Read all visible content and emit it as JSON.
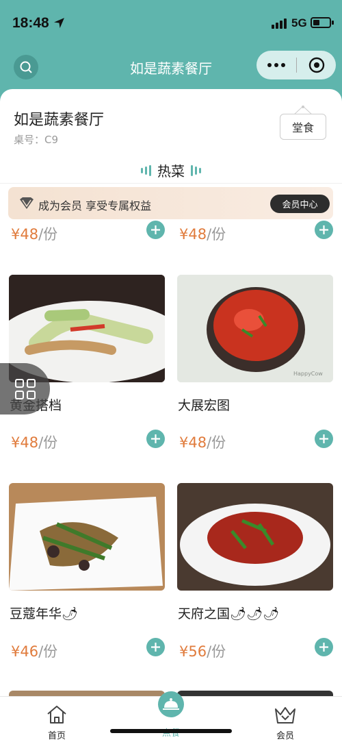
{
  "status": {
    "time": "18:48",
    "network": "5G"
  },
  "nav": {
    "title": "如是蔬素餐厅"
  },
  "restaurant": {
    "name": "如是蔬素餐厅",
    "table": "桌号：C9",
    "mode": "堂食"
  },
  "category": {
    "active": "热菜"
  },
  "member": {
    "text": "成为会员 享受专属权益",
    "button": "会员中心"
  },
  "items": [
    {
      "name": "",
      "price": "¥48",
      "unit": "/份"
    },
    {
      "name": "",
      "price": "¥48",
      "unit": "/份"
    },
    {
      "name": "黄金搭档",
      "price": "¥48",
      "unit": "/份"
    },
    {
      "name": "大展宏图",
      "price": "¥48",
      "unit": "/份"
    },
    {
      "name": "豆蔻年华🌶",
      "price": "¥46",
      "unit": "/份"
    },
    {
      "name": "天府之国🌶🌶🌶",
      "price": "¥56",
      "unit": "/份"
    }
  ],
  "watermark": "HappyCow",
  "tabbar": {
    "home": "首页",
    "center": "点餐",
    "member": "会员"
  },
  "colors": {
    "accent": "#5fb5ad",
    "price": "#e07b3c"
  }
}
